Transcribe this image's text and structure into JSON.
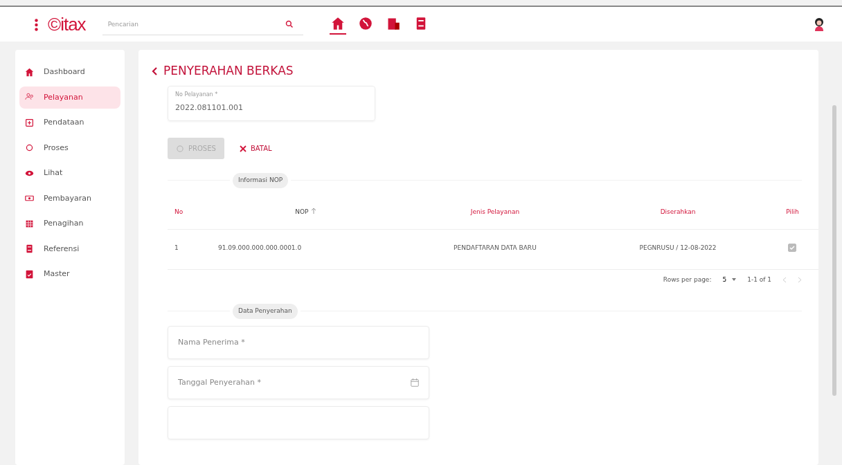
{
  "topbar": {
    "logo": "©itax",
    "search": {
      "placeholder": "Pencarian"
    },
    "nav_icons": [
      {
        "kind": "home",
        "selected": true
      },
      {
        "kind": "globe",
        "selected": false
      },
      {
        "kind": "building",
        "selected": false
      },
      {
        "kind": "book",
        "selected": false
      }
    ]
  },
  "sidebar": {
    "items": [
      {
        "label": "Dashboard",
        "kind": "home",
        "selected": false
      },
      {
        "label": "Pelayanan",
        "kind": "people",
        "selected": true
      },
      {
        "label": "Pendataan",
        "kind": "plusbox",
        "selected": false
      },
      {
        "label": "Proses",
        "kind": "cycle",
        "selected": false
      },
      {
        "label": "Lihat",
        "kind": "eye",
        "selected": false
      },
      {
        "label": "Pembayaran",
        "kind": "cash",
        "selected": false
      },
      {
        "label": "Penagihan",
        "kind": "grid",
        "selected": false
      },
      {
        "label": "Referensi",
        "kind": "book",
        "selected": false
      },
      {
        "label": "Master",
        "kind": "doc",
        "selected": false
      }
    ]
  },
  "page": {
    "title": "PENYERAHAN BERKAS",
    "no_pelayanan": {
      "label": "No Pelayanan *",
      "value": "2022.081101.001"
    },
    "buttons": [
      {
        "label": "PROSES",
        "kind": "proses",
        "disabled": true
      },
      {
        "label": "BATAL",
        "kind": "batal",
        "disabled": false
      }
    ],
    "section_1": "Informasi NOP",
    "table": {
      "columns": [
        {
          "label": "No",
          "sorted": false
        },
        {
          "label": "NOP",
          "sorted": true
        },
        {
          "label": "Jenis Pelayanan",
          "sorted": false
        },
        {
          "label": "Diserahkan",
          "sorted": false
        },
        {
          "label": "Pilih",
          "sorted": false
        }
      ],
      "rows": [
        {
          "no": "1",
          "nop": "91.09.000.000.000.0001.0",
          "jenis": "PENDAFTARAN DATA BARU",
          "diserahkan": "PEGNRUSU / 12-08-2022",
          "checked": true,
          "disabled": true
        }
      ],
      "pagination": {
        "rows_per_page_label": "Rows per page:",
        "rows_per_page": "5",
        "range": "1-1 of 1"
      }
    },
    "section_2": "Data Penyerahan",
    "fields": [
      {
        "placeholder": "Nama Penerima *",
        "kind": "text"
      },
      {
        "placeholder": "Tanggal Penyerahan *",
        "kind": "date"
      },
      {
        "kind": "text"
      }
    ]
  }
}
